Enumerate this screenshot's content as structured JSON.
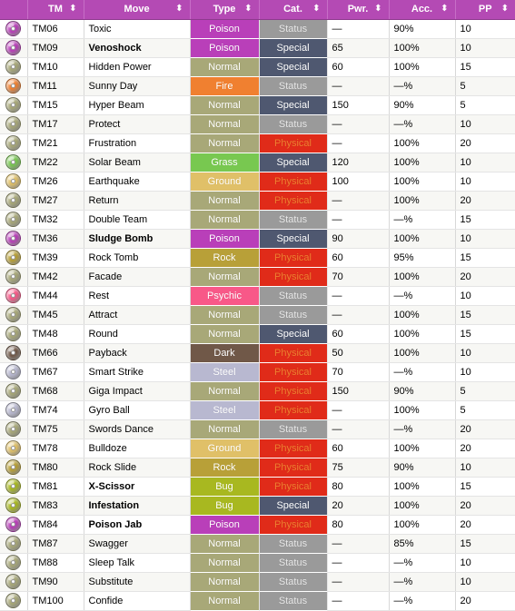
{
  "table": {
    "columns": [
      {
        "key": "icon",
        "label": "",
        "sortable": false
      },
      {
        "key": "tm",
        "label": "TM",
        "sortable": true
      },
      {
        "key": "move",
        "label": "Move",
        "sortable": true
      },
      {
        "key": "type",
        "label": "Type",
        "sortable": true
      },
      {
        "key": "cat",
        "label": "Cat.",
        "sortable": true
      },
      {
        "key": "pwr",
        "label": "Pwr.",
        "sortable": true
      },
      {
        "key": "acc",
        "label": "Acc.",
        "sortable": true
      },
      {
        "key": "pp",
        "label": "PP",
        "sortable": true
      }
    ],
    "sort_icon": "⬍",
    "header_bg": "#b44ab4",
    "type_colors": {
      "Normal": "#a8a878",
      "Fire": "#f08030",
      "Grass": "#78c850",
      "Ground": "#e0c068",
      "Rock": "#b8a038",
      "Poison": "#b93fb9",
      "Psychic": "#f85888",
      "Dark": "#705848",
      "Steel": "#b8b8d0",
      "Bug": "#a8b820"
    },
    "cat_colors": {
      "Status": "#9a9a9a",
      "Special": "#4f5870",
      "Physical": "#e02b19"
    },
    "cat_text_colors": {
      "Status": "#e8e8e8",
      "Special": "#ffffff",
      "Physical": "#f08030"
    },
    "rows": [
      {
        "tm": "TM06",
        "move": "Toxic",
        "bold": false,
        "type": "Poison",
        "cat": "Status",
        "pwr": "—",
        "acc": "90%",
        "pp": "10"
      },
      {
        "tm": "TM09",
        "move": "Venoshock",
        "bold": true,
        "type": "Poison",
        "cat": "Special",
        "pwr": "65",
        "acc": "100%",
        "pp": "10"
      },
      {
        "tm": "TM10",
        "move": "Hidden Power",
        "bold": false,
        "type": "Normal",
        "cat": "Special",
        "pwr": "60",
        "acc": "100%",
        "pp": "15"
      },
      {
        "tm": "TM11",
        "move": "Sunny Day",
        "bold": false,
        "type": "Fire",
        "cat": "Status",
        "pwr": "—",
        "acc": "—%",
        "pp": "5"
      },
      {
        "tm": "TM15",
        "move": "Hyper Beam",
        "bold": false,
        "type": "Normal",
        "cat": "Special",
        "pwr": "150",
        "acc": "90%",
        "pp": "5"
      },
      {
        "tm": "TM17",
        "move": "Protect",
        "bold": false,
        "type": "Normal",
        "cat": "Status",
        "pwr": "—",
        "acc": "—%",
        "pp": "10"
      },
      {
        "tm": "TM21",
        "move": "Frustration",
        "bold": false,
        "type": "Normal",
        "cat": "Physical",
        "pwr": "—",
        "acc": "100%",
        "pp": "20"
      },
      {
        "tm": "TM22",
        "move": "Solar Beam",
        "bold": false,
        "type": "Grass",
        "cat": "Special",
        "pwr": "120",
        "acc": "100%",
        "pp": "10"
      },
      {
        "tm": "TM26",
        "move": "Earthquake",
        "bold": false,
        "type": "Ground",
        "cat": "Physical",
        "pwr": "100",
        "acc": "100%",
        "pp": "10"
      },
      {
        "tm": "TM27",
        "move": "Return",
        "bold": false,
        "type": "Normal",
        "cat": "Physical",
        "pwr": "—",
        "acc": "100%",
        "pp": "20"
      },
      {
        "tm": "TM32",
        "move": "Double Team",
        "bold": false,
        "type": "Normal",
        "cat": "Status",
        "pwr": "—",
        "acc": "—%",
        "pp": "15"
      },
      {
        "tm": "TM36",
        "move": "Sludge Bomb",
        "bold": true,
        "type": "Poison",
        "cat": "Special",
        "pwr": "90",
        "acc": "100%",
        "pp": "10"
      },
      {
        "tm": "TM39",
        "move": "Rock Tomb",
        "bold": false,
        "type": "Rock",
        "cat": "Physical",
        "pwr": "60",
        "acc": "95%",
        "pp": "15"
      },
      {
        "tm": "TM42",
        "move": "Facade",
        "bold": false,
        "type": "Normal",
        "cat": "Physical",
        "pwr": "70",
        "acc": "100%",
        "pp": "20"
      },
      {
        "tm": "TM44",
        "move": "Rest",
        "bold": false,
        "type": "Psychic",
        "cat": "Status",
        "pwr": "—",
        "acc": "—%",
        "pp": "10"
      },
      {
        "tm": "TM45",
        "move": "Attract",
        "bold": false,
        "type": "Normal",
        "cat": "Status",
        "pwr": "—",
        "acc": "100%",
        "pp": "15"
      },
      {
        "tm": "TM48",
        "move": "Round",
        "bold": false,
        "type": "Normal",
        "cat": "Special",
        "pwr": "60",
        "acc": "100%",
        "pp": "15"
      },
      {
        "tm": "TM66",
        "move": "Payback",
        "bold": false,
        "type": "Dark",
        "cat": "Physical",
        "pwr": "50",
        "acc": "100%",
        "pp": "10"
      },
      {
        "tm": "TM67",
        "move": "Smart Strike",
        "bold": false,
        "type": "Steel",
        "cat": "Physical",
        "pwr": "70",
        "acc": "—%",
        "pp": "10"
      },
      {
        "tm": "TM68",
        "move": "Giga Impact",
        "bold": false,
        "type": "Normal",
        "cat": "Physical",
        "pwr": "150",
        "acc": "90%",
        "pp": "5"
      },
      {
        "tm": "TM74",
        "move": "Gyro Ball",
        "bold": false,
        "type": "Steel",
        "cat": "Physical",
        "pwr": "—",
        "acc": "100%",
        "pp": "5"
      },
      {
        "tm": "TM75",
        "move": "Swords Dance",
        "bold": false,
        "type": "Normal",
        "cat": "Status",
        "pwr": "—",
        "acc": "—%",
        "pp": "20"
      },
      {
        "tm": "TM78",
        "move": "Bulldoze",
        "bold": false,
        "type": "Ground",
        "cat": "Physical",
        "pwr": "60",
        "acc": "100%",
        "pp": "20"
      },
      {
        "tm": "TM80",
        "move": "Rock Slide",
        "bold": false,
        "type": "Rock",
        "cat": "Physical",
        "pwr": "75",
        "acc": "90%",
        "pp": "10"
      },
      {
        "tm": "TM81",
        "move": "X-Scissor",
        "bold": true,
        "type": "Bug",
        "cat": "Physical",
        "pwr": "80",
        "acc": "100%",
        "pp": "15"
      },
      {
        "tm": "TM83",
        "move": "Infestation",
        "bold": true,
        "type": "Bug",
        "cat": "Special",
        "pwr": "20",
        "acc": "100%",
        "pp": "20"
      },
      {
        "tm": "TM84",
        "move": "Poison Jab",
        "bold": true,
        "type": "Poison",
        "cat": "Physical",
        "pwr": "80",
        "acc": "100%",
        "pp": "20"
      },
      {
        "tm": "TM87",
        "move": "Swagger",
        "bold": false,
        "type": "Normal",
        "cat": "Status",
        "pwr": "—",
        "acc": "85%",
        "pp": "15"
      },
      {
        "tm": "TM88",
        "move": "Sleep Talk",
        "bold": false,
        "type": "Normal",
        "cat": "Status",
        "pwr": "—",
        "acc": "—%",
        "pp": "10"
      },
      {
        "tm": "TM90",
        "move": "Substitute",
        "bold": false,
        "type": "Normal",
        "cat": "Status",
        "pwr": "—",
        "acc": "—%",
        "pp": "10"
      },
      {
        "tm": "TM100",
        "move": "Confide",
        "bold": false,
        "type": "Normal",
        "cat": "Status",
        "pwr": "—",
        "acc": "—%",
        "pp": "20"
      }
    ]
  }
}
